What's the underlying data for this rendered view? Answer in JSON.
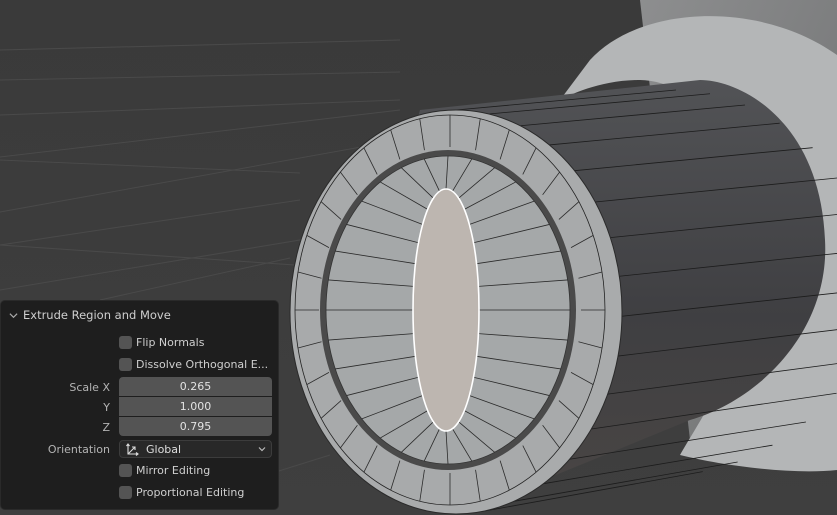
{
  "operator_panel": {
    "title": "Extrude Region and Move",
    "collapsed": false,
    "flip_normals": {
      "label": "Flip Normals",
      "checked": false
    },
    "dissolve_orthogonal": {
      "label": "Dissolve Orthogonal E...",
      "checked": false
    },
    "scale": {
      "label_x": "Scale X",
      "label_y": "Y",
      "label_z": "Z",
      "x": "0.265",
      "y": "1.000",
      "z": "0.795"
    },
    "orientation": {
      "label": "Orientation",
      "value": "Global",
      "icon": "orientation-global-icon"
    },
    "mirror_editing": {
      "label": "Mirror Editing",
      "checked": false
    },
    "proportional_editing": {
      "label": "Proportional Editing",
      "checked": false
    }
  },
  "viewport": {
    "background_color": "#3d3d3d",
    "mesh_face_color": "#a7aaab",
    "selected_face_color": "#bdb6b0",
    "selection_outline_color": "#ffffff",
    "cylinder_side_color": "#444446",
    "outer_ring_color": "#b4b6b7"
  }
}
